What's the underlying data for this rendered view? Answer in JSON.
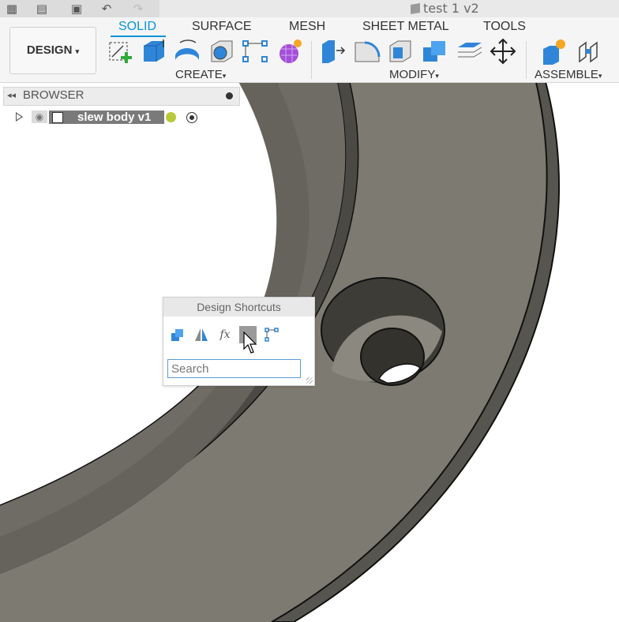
{
  "window": {
    "title": "test 1 v2"
  },
  "toolbar": {
    "workspace_label": "DESIGN",
    "tabs": [
      {
        "label": "SOLID",
        "active": true
      },
      {
        "label": "SURFACE",
        "active": false
      },
      {
        "label": "MESH",
        "active": false
      },
      {
        "label": "SHEET METAL",
        "active": false
      },
      {
        "label": "TOOLS",
        "active": false
      }
    ],
    "groups": {
      "create": "CREATE",
      "modify": "MODIFY",
      "assemble": "ASSEMBLE"
    },
    "accent_color": "#0696d7"
  },
  "browser": {
    "title": "BROWSER",
    "root_node": {
      "label": "slew body v1"
    }
  },
  "shortcuts": {
    "title": "Design Shortcuts",
    "icons": [
      "combine-icon",
      "mirror-icon",
      "fx-parameters-icon",
      "highlighted-tool-icon",
      "sketch-dimension-icon"
    ],
    "search": {
      "placeholder": "Search",
      "value": ""
    }
  },
  "colors": {
    "model_surface": "#7d7a72",
    "model_shadow": "#55534d",
    "toolbar_bg": "#f5f5f5"
  }
}
